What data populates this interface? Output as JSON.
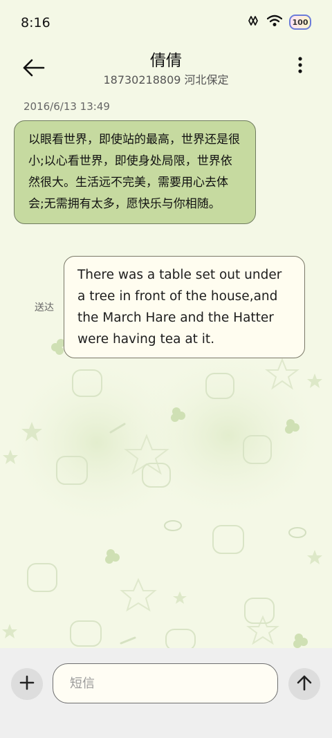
{
  "status_bar": {
    "time": "8:16",
    "battery_level": "100",
    "icons": [
      "nfc-icon",
      "wifi-icon",
      "battery-icon"
    ]
  },
  "header": {
    "contact_name": "倩倩",
    "contact_detail": "18730218809 河北保定",
    "back_icon": "back-arrow-icon",
    "more_icon": "more-vertical-icon"
  },
  "conversation": {
    "timestamp": "2016/6/13 13:49",
    "messages": [
      {
        "direction": "incoming",
        "text": "以眼看世界，即使站的最高，世界还是很小;以心看世界，即使身处局限，世界依然很大。生活远不完美，需要用心去体会;无需拥有太多，愿快乐与你相随。"
      },
      {
        "direction": "outgoing",
        "text": "There was a table set out under a tree in front of the house,and the March Hare and the Hatter were having tea at it.",
        "status": "送达"
      }
    ]
  },
  "composer": {
    "placeholder": "短信",
    "add_icon": "plus-icon",
    "send_icon": "send-arrow-up-icon"
  },
  "colors": {
    "background": "#f4f8e6",
    "incoming_bubble": "#c6daa0",
    "outgoing_bubble": "#fffdf0",
    "bottom_bar": "#efefef"
  }
}
